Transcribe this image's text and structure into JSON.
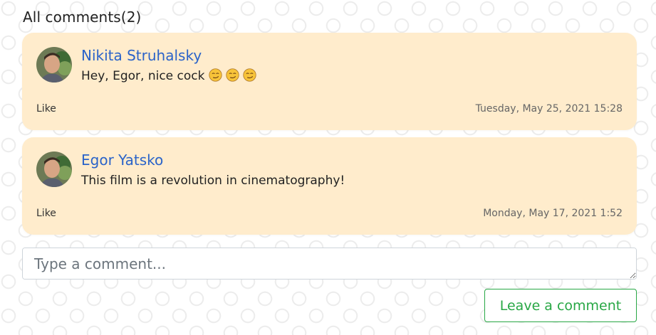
{
  "section": {
    "title": "All comments(2)"
  },
  "comments": [
    {
      "author": "Nikita Struhalsky",
      "text": "Hey, Egor, nice cock",
      "emojis": [
        "smirking-face",
        "smirking-face",
        "smirking-face"
      ],
      "like_label": "Like",
      "date": "Tuesday, May 25, 2021 15:28"
    },
    {
      "author": "Egor Yatsko",
      "text": "This film is a revolution in cinematography!",
      "emojis": [],
      "like_label": "Like",
      "date": "Monday, May 17, 2021 1:52"
    }
  ],
  "form": {
    "placeholder": "Type a comment...",
    "submit_label": "Leave a comment"
  },
  "colors": {
    "card_background": "#ffeccc",
    "author_link": "#2a63c9",
    "submit_accent": "#28a745"
  }
}
